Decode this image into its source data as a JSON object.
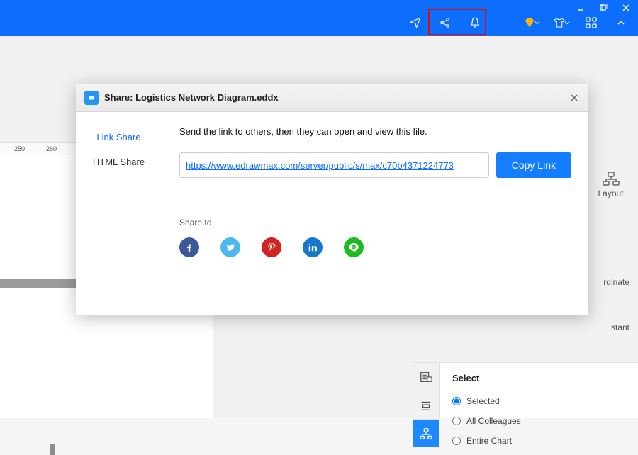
{
  "titlebar": {
    "icons": {
      "send": "send-icon",
      "share": "share-icon",
      "bell": "bell-icon",
      "diamond": "diamond-icon",
      "shirt": "shirt-icon",
      "apps": "apps-icon",
      "chevron": "chevron-up-icon"
    },
    "window": {
      "min": "—",
      "max": "❐",
      "close": "✕"
    }
  },
  "ruler": {
    "m250": "250",
    "m260": "260"
  },
  "rightpanel": {
    "layout_label": "Layout",
    "ordinate": "rdinate",
    "stant": "stant"
  },
  "selectPanel": {
    "title": "Select",
    "opt1": "Selected",
    "opt2": "All Colleagues",
    "opt3": "Entire Chart"
  },
  "modal": {
    "title": "Share: Logistics Network Diagram.eddx",
    "tabs": {
      "link": "Link Share",
      "html": "HTML Share"
    },
    "desc": "Send the link to others, then they can open and view this file.",
    "url": "https://www.edrawmax.com/server/public/s/max/c70b4371224773",
    "copy": "Copy Link",
    "share_to": "Share to",
    "social": {
      "fb": "f",
      "tw": "t",
      "pt": "P",
      "in": "in",
      "line": "○"
    }
  }
}
